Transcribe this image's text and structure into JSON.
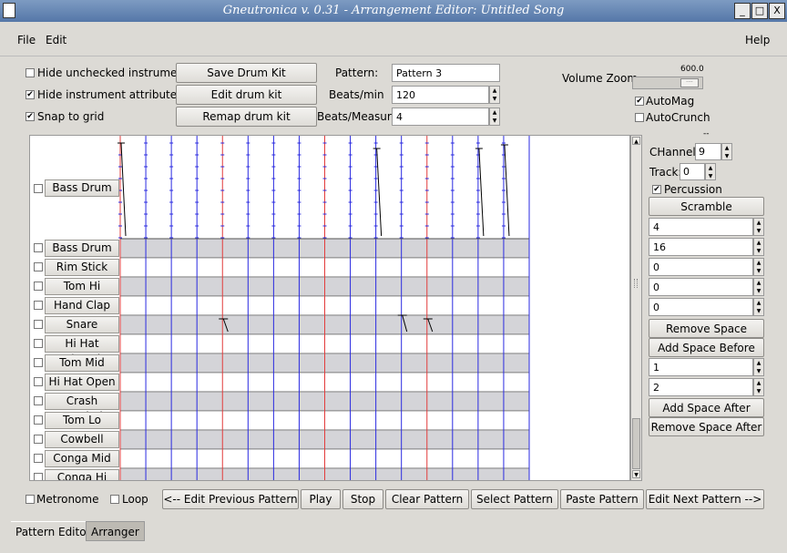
{
  "window": {
    "title": "Gneutronica v. 0.31 - Arrangement Editor: Untitled Song",
    "minimize": "_",
    "maximize": "□",
    "close": "X"
  },
  "menu": {
    "file": "File",
    "edit": "Edit",
    "help": "Help"
  },
  "options": {
    "hide_unchecked": {
      "label": "Hide unchecked instruments",
      "checked": false
    },
    "hide_attributes": {
      "label": "Hide instrument attributes",
      "checked": true
    },
    "snap": {
      "label": "Snap to grid",
      "checked": true
    }
  },
  "kit_buttons": {
    "save": "Save Drum Kit",
    "edit": "Edit drum kit",
    "remap": "Remap drum kit"
  },
  "pattern": {
    "pattern_label": "Pattern:",
    "pattern_value": "Pattern 3",
    "bpm_label": "Beats/min",
    "bpm_value": "120",
    "bpmeasure_label": "Beats/Measure",
    "bpmeasure_value": "4"
  },
  "volume": {
    "label": "Volume Zoom",
    "value": "600.0",
    "slider_text": "····",
    "automag": {
      "label": "AutoMag",
      "checked": true
    },
    "autocrunch": {
      "label": "AutoCrunch",
      "checked": false
    }
  },
  "right_panel": {
    "dashes": "--",
    "channel_label": "CHannel:",
    "channel_value": "9",
    "track_label": "Track:",
    "track_value": "0",
    "percussion": {
      "label": "Percussion",
      "checked": true
    },
    "scramble": "Scramble",
    "spin_values_a": [
      "4",
      "16",
      "0",
      "0",
      "0"
    ],
    "remove_space_before": "Remove Space Before",
    "add_space_before": "Add Space Before",
    "spin_values_b": [
      "1",
      "2"
    ],
    "add_space_after": "Add Space After",
    "remove_space_after": "Remove Space After"
  },
  "volume_lane": {
    "instrument": "Bass Drum"
  },
  "instruments": [
    "Bass Drum",
    "Rim Stick",
    "Tom Hi",
    "Hand Clap",
    "Snare",
    "Hi Hat Closed",
    "Tom Mid",
    "Hi Hat Open",
    "Crash Cymbal",
    "Tom Lo",
    "Cowbell",
    "Conga Mid",
    "Conga Hi"
  ],
  "bottom": {
    "metronome": {
      "label": "Metronome",
      "checked": false
    },
    "loop": {
      "label": "Loop",
      "checked": false
    },
    "buttons": [
      "<-- Edit Previous Pattern",
      "Play",
      "Stop",
      "Clear Pattern",
      "Select Pattern",
      "Paste Pattern",
      "Edit Next Pattern -->"
    ]
  },
  "tabs": [
    "Pattern Editor",
    "Arranger"
  ],
  "colors": {
    "measure_line": "#e23c3c",
    "beat_line": "#2a2ae0",
    "shaded_row": "#d4d4d8"
  }
}
